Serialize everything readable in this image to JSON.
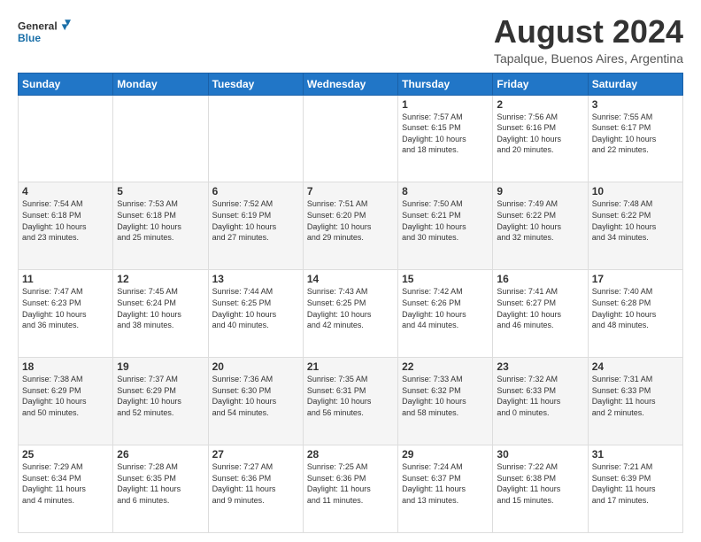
{
  "logo": {
    "general": "General",
    "blue": "Blue"
  },
  "title": "August 2024",
  "location": "Tapalque, Buenos Aires, Argentina",
  "days_header": [
    "Sunday",
    "Monday",
    "Tuesday",
    "Wednesday",
    "Thursday",
    "Friday",
    "Saturday"
  ],
  "weeks": [
    [
      {
        "day": "",
        "info": ""
      },
      {
        "day": "",
        "info": ""
      },
      {
        "day": "",
        "info": ""
      },
      {
        "day": "",
        "info": ""
      },
      {
        "day": "1",
        "info": "Sunrise: 7:57 AM\nSunset: 6:15 PM\nDaylight: 10 hours\nand 18 minutes."
      },
      {
        "day": "2",
        "info": "Sunrise: 7:56 AM\nSunset: 6:16 PM\nDaylight: 10 hours\nand 20 minutes."
      },
      {
        "day": "3",
        "info": "Sunrise: 7:55 AM\nSunset: 6:17 PM\nDaylight: 10 hours\nand 22 minutes."
      }
    ],
    [
      {
        "day": "4",
        "info": "Sunrise: 7:54 AM\nSunset: 6:18 PM\nDaylight: 10 hours\nand 23 minutes."
      },
      {
        "day": "5",
        "info": "Sunrise: 7:53 AM\nSunset: 6:18 PM\nDaylight: 10 hours\nand 25 minutes."
      },
      {
        "day": "6",
        "info": "Sunrise: 7:52 AM\nSunset: 6:19 PM\nDaylight: 10 hours\nand 27 minutes."
      },
      {
        "day": "7",
        "info": "Sunrise: 7:51 AM\nSunset: 6:20 PM\nDaylight: 10 hours\nand 29 minutes."
      },
      {
        "day": "8",
        "info": "Sunrise: 7:50 AM\nSunset: 6:21 PM\nDaylight: 10 hours\nand 30 minutes."
      },
      {
        "day": "9",
        "info": "Sunrise: 7:49 AM\nSunset: 6:22 PM\nDaylight: 10 hours\nand 32 minutes."
      },
      {
        "day": "10",
        "info": "Sunrise: 7:48 AM\nSunset: 6:22 PM\nDaylight: 10 hours\nand 34 minutes."
      }
    ],
    [
      {
        "day": "11",
        "info": "Sunrise: 7:47 AM\nSunset: 6:23 PM\nDaylight: 10 hours\nand 36 minutes."
      },
      {
        "day": "12",
        "info": "Sunrise: 7:45 AM\nSunset: 6:24 PM\nDaylight: 10 hours\nand 38 minutes."
      },
      {
        "day": "13",
        "info": "Sunrise: 7:44 AM\nSunset: 6:25 PM\nDaylight: 10 hours\nand 40 minutes."
      },
      {
        "day": "14",
        "info": "Sunrise: 7:43 AM\nSunset: 6:25 PM\nDaylight: 10 hours\nand 42 minutes."
      },
      {
        "day": "15",
        "info": "Sunrise: 7:42 AM\nSunset: 6:26 PM\nDaylight: 10 hours\nand 44 minutes."
      },
      {
        "day": "16",
        "info": "Sunrise: 7:41 AM\nSunset: 6:27 PM\nDaylight: 10 hours\nand 46 minutes."
      },
      {
        "day": "17",
        "info": "Sunrise: 7:40 AM\nSunset: 6:28 PM\nDaylight: 10 hours\nand 48 minutes."
      }
    ],
    [
      {
        "day": "18",
        "info": "Sunrise: 7:38 AM\nSunset: 6:29 PM\nDaylight: 10 hours\nand 50 minutes."
      },
      {
        "day": "19",
        "info": "Sunrise: 7:37 AM\nSunset: 6:29 PM\nDaylight: 10 hours\nand 52 minutes."
      },
      {
        "day": "20",
        "info": "Sunrise: 7:36 AM\nSunset: 6:30 PM\nDaylight: 10 hours\nand 54 minutes."
      },
      {
        "day": "21",
        "info": "Sunrise: 7:35 AM\nSunset: 6:31 PM\nDaylight: 10 hours\nand 56 minutes."
      },
      {
        "day": "22",
        "info": "Sunrise: 7:33 AM\nSunset: 6:32 PM\nDaylight: 10 hours\nand 58 minutes."
      },
      {
        "day": "23",
        "info": "Sunrise: 7:32 AM\nSunset: 6:33 PM\nDaylight: 11 hours\nand 0 minutes."
      },
      {
        "day": "24",
        "info": "Sunrise: 7:31 AM\nSunset: 6:33 PM\nDaylight: 11 hours\nand 2 minutes."
      }
    ],
    [
      {
        "day": "25",
        "info": "Sunrise: 7:29 AM\nSunset: 6:34 PM\nDaylight: 11 hours\nand 4 minutes."
      },
      {
        "day": "26",
        "info": "Sunrise: 7:28 AM\nSunset: 6:35 PM\nDaylight: 11 hours\nand 6 minutes."
      },
      {
        "day": "27",
        "info": "Sunrise: 7:27 AM\nSunset: 6:36 PM\nDaylight: 11 hours\nand 9 minutes."
      },
      {
        "day": "28",
        "info": "Sunrise: 7:25 AM\nSunset: 6:36 PM\nDaylight: 11 hours\nand 11 minutes."
      },
      {
        "day": "29",
        "info": "Sunrise: 7:24 AM\nSunset: 6:37 PM\nDaylight: 11 hours\nand 13 minutes."
      },
      {
        "day": "30",
        "info": "Sunrise: 7:22 AM\nSunset: 6:38 PM\nDaylight: 11 hours\nand 15 minutes."
      },
      {
        "day": "31",
        "info": "Sunrise: 7:21 AM\nSunset: 6:39 PM\nDaylight: 11 hours\nand 17 minutes."
      }
    ]
  ]
}
